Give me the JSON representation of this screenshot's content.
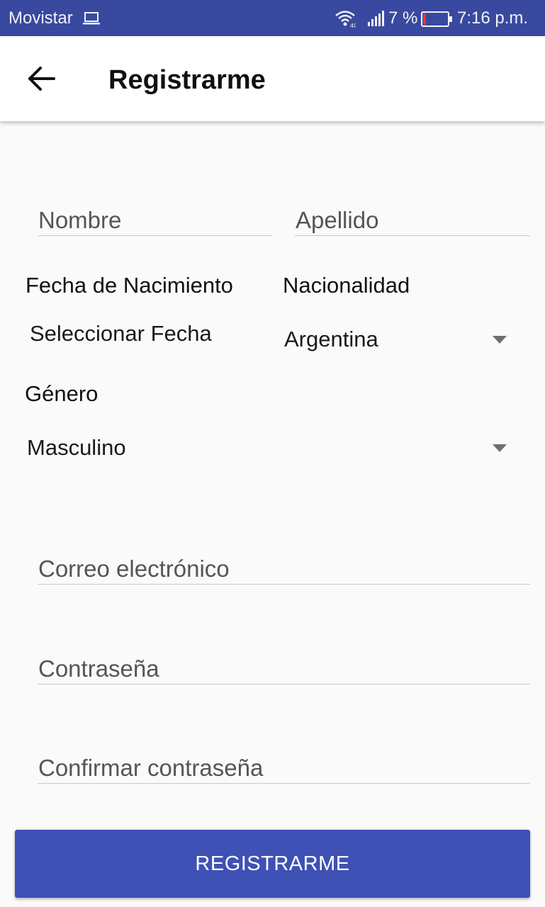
{
  "status_bar": {
    "carrier": "Movistar",
    "battery_percent": "7 %",
    "time": "7:16 p.m.",
    "icons": [
      "laptop-icon",
      "wifi-icon",
      "signal-icon",
      "battery-icon"
    ],
    "battery_level": 0.07
  },
  "app_bar": {
    "back_icon": "arrow-left-icon",
    "title": "Registrarme"
  },
  "form": {
    "first_name": {
      "placeholder": "Nombre",
      "value": ""
    },
    "last_name": {
      "placeholder": "Apellido",
      "value": ""
    },
    "birth_date": {
      "label": "Fecha de Nacimiento",
      "action": "Seleccionar Fecha"
    },
    "nationality": {
      "label": "Nacionalidad",
      "selected": "Argentina"
    },
    "gender": {
      "label": "Género",
      "selected": "Masculino"
    },
    "email": {
      "placeholder": "Correo electrónico",
      "value": ""
    },
    "password": {
      "placeholder": "Contraseña",
      "value": ""
    },
    "confirm_password": {
      "placeholder": "Confirmar contraseña",
      "value": ""
    }
  },
  "submit_button": {
    "label": "REGISTRARME"
  },
  "colors": {
    "status_bar": "#3949a0",
    "primary": "#3f51b5",
    "battery_low": "#e53935"
  }
}
